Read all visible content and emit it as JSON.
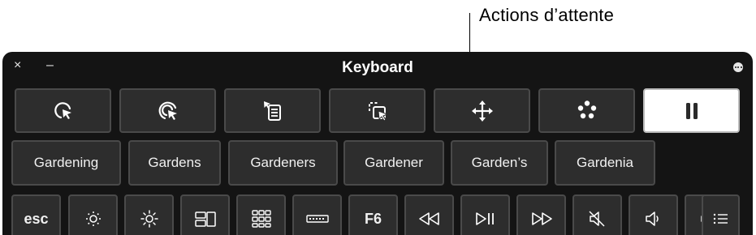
{
  "callout": {
    "label": "Actions d’attente"
  },
  "window": {
    "title": "Keyboard",
    "close_glyph": "×",
    "minimize_glyph": "–",
    "more_icon": "ellipsis-circle-icon"
  },
  "dwell_actions": [
    {
      "icon": "left-click-icon"
    },
    {
      "icon": "double-click-icon"
    },
    {
      "icon": "context-menu-icon"
    },
    {
      "icon": "drag-drop-icon"
    },
    {
      "icon": "scroll-move-icon"
    },
    {
      "icon": "dwell-menu-icon"
    },
    {
      "icon": "pause-icon",
      "active": true
    }
  ],
  "suggestions": [
    "Gardening",
    "Gardens",
    "Gardeners",
    "Gardener",
    "Garden’s",
    "Gardenia"
  ],
  "function_keys": {
    "esc": "esc",
    "f6": "F6",
    "icons": [
      "brightness-down-icon",
      "brightness-up-icon",
      "mission-control-icon",
      "launchpad-icon",
      "keyboard-brightness-icon",
      "rewind-icon",
      "play-pause-icon",
      "fast-forward-icon",
      "mute-icon",
      "volume-down-icon",
      "volume-up-icon",
      "list-icon"
    ]
  },
  "colors": {
    "window_bg": "#141414",
    "key_bg": "#2d2d2d",
    "key_border": "#4a4a4a",
    "active_key_bg": "#ffffff"
  }
}
